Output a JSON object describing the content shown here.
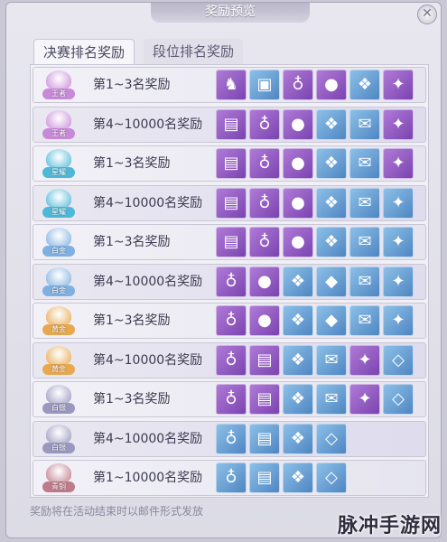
{
  "window": {
    "title": "奖励预览"
  },
  "tabs": [
    {
      "label": "决赛排名奖励"
    },
    {
      "label": "段位排名奖励"
    }
  ],
  "colors": {
    "wangzhe": "#c88ad8",
    "xingyao": "#4fb8d8",
    "baijin": "#7fb0e0",
    "huangjin": "#e8a850",
    "baiyin": "#9a98c0",
    "qingtong": "#c07a8a"
  },
  "rows": [
    {
      "tier": "王者",
      "tier_color": "wangzhe",
      "label": "第1~3名奖励",
      "items": [
        {
          "icon": "armor-icon",
          "glyph": "♞",
          "q": "purple"
        },
        {
          "icon": "crystal-chest-icon",
          "glyph": "▣",
          "q": "blue"
        },
        {
          "icon": "money-bag-icon",
          "glyph": "♁",
          "q": "purple"
        },
        {
          "icon": "red-orb-icon",
          "glyph": "●",
          "q": "purple"
        },
        {
          "icon": "blue-crystal-icon",
          "glyph": "❖",
          "q": "blue"
        },
        {
          "icon": "purple-gem-icon",
          "glyph": "✦",
          "q": "purple"
        }
      ]
    },
    {
      "tier": "王者",
      "tier_color": "wangzhe",
      "label": "第4~10000名奖励",
      "items": [
        {
          "icon": "chest-icon",
          "glyph": "▤",
          "q": "purple"
        },
        {
          "icon": "money-bag-icon",
          "glyph": "♁",
          "q": "purple"
        },
        {
          "icon": "red-orb-icon",
          "glyph": "●",
          "q": "purple"
        },
        {
          "icon": "blue-crystal-icon",
          "glyph": "❖",
          "q": "blue"
        },
        {
          "icon": "scroll-icon",
          "glyph": "✉",
          "q": "blue"
        },
        {
          "icon": "purple-gem-icon",
          "glyph": "✦",
          "q": "purple"
        }
      ]
    },
    {
      "tier": "星耀",
      "tier_color": "xingyao",
      "label": "第1~3名奖励",
      "items": [
        {
          "icon": "chest-icon",
          "glyph": "▤",
          "q": "purple"
        },
        {
          "icon": "money-bag-icon",
          "glyph": "♁",
          "q": "purple"
        },
        {
          "icon": "red-orb-icon",
          "glyph": "●",
          "q": "purple"
        },
        {
          "icon": "blue-crystal-icon",
          "glyph": "❖",
          "q": "blue"
        },
        {
          "icon": "scroll-icon",
          "glyph": "✉",
          "q": "blue"
        },
        {
          "icon": "purple-gem-icon",
          "glyph": "✦",
          "q": "purple"
        }
      ]
    },
    {
      "tier": "星耀",
      "tier_color": "xingyao",
      "label": "第4~10000名奖励",
      "items": [
        {
          "icon": "chest-icon",
          "glyph": "▤",
          "q": "purple"
        },
        {
          "icon": "money-bag-icon",
          "glyph": "♁",
          "q": "purple"
        },
        {
          "icon": "red-orb-icon",
          "glyph": "●",
          "q": "purple"
        },
        {
          "icon": "blue-crystal-icon",
          "glyph": "❖",
          "q": "blue"
        },
        {
          "icon": "scroll-icon",
          "glyph": "✉",
          "q": "blue"
        },
        {
          "icon": "blue-gem-icon",
          "glyph": "✦",
          "q": "blue"
        }
      ]
    },
    {
      "tier": "白金",
      "tier_color": "baijin",
      "label": "第1~3名奖励",
      "items": [
        {
          "icon": "chest-icon",
          "glyph": "▤",
          "q": "purple"
        },
        {
          "icon": "money-bag-icon",
          "glyph": "♁",
          "q": "purple"
        },
        {
          "icon": "red-orb-icon",
          "glyph": "●",
          "q": "purple"
        },
        {
          "icon": "blue-crystal-icon",
          "glyph": "❖",
          "q": "blue"
        },
        {
          "icon": "scroll-icon",
          "glyph": "✉",
          "q": "blue"
        },
        {
          "icon": "blue-gem-icon",
          "glyph": "✦",
          "q": "blue"
        }
      ]
    },
    {
      "tier": "白金",
      "tier_color": "baijin",
      "label": "第4~10000名奖励",
      "items": [
        {
          "icon": "money-bag-icon",
          "glyph": "♁",
          "q": "purple"
        },
        {
          "icon": "red-orb-icon",
          "glyph": "●",
          "q": "purple"
        },
        {
          "icon": "blue-crystal-icon",
          "glyph": "❖",
          "q": "blue"
        },
        {
          "icon": "gold-crystal-icon",
          "glyph": "◆",
          "q": "blue"
        },
        {
          "icon": "scroll-icon",
          "glyph": "✉",
          "q": "blue"
        },
        {
          "icon": "blue-gem-icon",
          "glyph": "✦",
          "q": "blue"
        }
      ]
    },
    {
      "tier": "黄金",
      "tier_color": "huangjin",
      "label": "第1~3名奖励",
      "items": [
        {
          "icon": "money-bag-icon",
          "glyph": "♁",
          "q": "purple"
        },
        {
          "icon": "red-orb-icon",
          "glyph": "●",
          "q": "purple"
        },
        {
          "icon": "blue-crystal-icon",
          "glyph": "❖",
          "q": "blue"
        },
        {
          "icon": "gold-crystal-icon",
          "glyph": "◆",
          "q": "blue"
        },
        {
          "icon": "scroll-icon",
          "glyph": "✉",
          "q": "blue"
        },
        {
          "icon": "blue-gem-icon",
          "glyph": "✦",
          "q": "blue"
        }
      ]
    },
    {
      "tier": "黄金",
      "tier_color": "huangjin",
      "label": "第4~10000名奖励",
      "items": [
        {
          "icon": "money-bag-icon",
          "glyph": "♁",
          "q": "purple"
        },
        {
          "icon": "chest-icon",
          "glyph": "▤",
          "q": "purple"
        },
        {
          "icon": "green-crystal-icon",
          "glyph": "❖",
          "q": "blue"
        },
        {
          "icon": "scroll-icon",
          "glyph": "✉",
          "q": "blue"
        },
        {
          "icon": "blue-gem-icon",
          "glyph": "✦",
          "q": "purple"
        },
        {
          "icon": "white-gem-icon",
          "glyph": "◇",
          "q": "blue"
        }
      ]
    },
    {
      "tier": "白银",
      "tier_color": "baiyin",
      "label": "第1~3名奖励",
      "items": [
        {
          "icon": "money-bag-icon",
          "glyph": "♁",
          "q": "purple"
        },
        {
          "icon": "chest-icon",
          "glyph": "▤",
          "q": "purple"
        },
        {
          "icon": "green-crystal-icon",
          "glyph": "❖",
          "q": "blue"
        },
        {
          "icon": "scroll-icon",
          "glyph": "✉",
          "q": "blue"
        },
        {
          "icon": "blue-gem-icon",
          "glyph": "✦",
          "q": "purple"
        },
        {
          "icon": "white-gem-icon",
          "glyph": "◇",
          "q": "blue"
        }
      ]
    },
    {
      "tier": "白银",
      "tier_color": "baiyin",
      "label": "第4~10000名奖励",
      "items": [
        {
          "icon": "money-bag-icon",
          "glyph": "♁",
          "q": "blue"
        },
        {
          "icon": "chest-icon",
          "glyph": "▤",
          "q": "blue"
        },
        {
          "icon": "green-crystal-icon",
          "glyph": "❖",
          "q": "blue"
        },
        {
          "icon": "white-gem-icon",
          "glyph": "◇",
          "q": "blue"
        }
      ]
    },
    {
      "tier": "青铜",
      "tier_color": "qingtong",
      "label": "第1~10000名奖励",
      "items": [
        {
          "icon": "money-bag-icon",
          "glyph": "♁",
          "q": "blue"
        },
        {
          "icon": "chest-icon",
          "glyph": "▤",
          "q": "blue"
        },
        {
          "icon": "green-crystal-icon",
          "glyph": "❖",
          "q": "blue"
        },
        {
          "icon": "white-gem-icon",
          "glyph": "◇",
          "q": "blue"
        }
      ]
    }
  ],
  "footer": {
    "note": "奖励将在活动结束时以邮件形式发放"
  },
  "watermark": "脉冲手游网"
}
